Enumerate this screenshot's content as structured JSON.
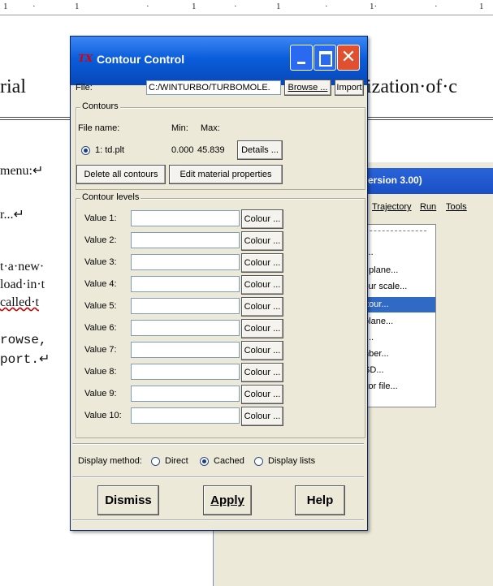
{
  "document": {
    "heading_left": "rial",
    "heading_right": "ization·of·c",
    "lines": [
      {
        "text": "menu:↵",
        "mono": false
      },
      {
        "text": "r...↵",
        "mono": false
      },
      {
        "text": "t·a·new·",
        "mono": false
      },
      {
        "text": "load·in·t",
        "mono": false
      },
      {
        "text": "called·t",
        "mono": false
      },
      {
        "text": "rowse,",
        "mono": true
      },
      {
        "text": "port.↵",
        "mono": true
      }
    ]
  },
  "bg_window": {
    "title": "ersion 3.00)",
    "menubar": [
      "Trajectory",
      "Run",
      "Tools"
    ],
    "menu_items": [
      "s...",
      "p plane...",
      "lour scale...",
      "ntour...",
      "tplane...",
      "P...",
      "mber...",
      "ISD...",
      "ctor file..."
    ],
    "selected_index": 3
  },
  "dialog": {
    "title": "Contour Control",
    "icon_text": "TX",
    "file_label": "File:",
    "file_value": "C:/WINTURBO/TURBOMOLE.",
    "browse_label": "Browse ...",
    "import_label": "Import",
    "contours": {
      "group_title": "Contours",
      "col_file": "File name:",
      "col_min": "Min:",
      "col_max": "Max:",
      "entry_name": "1: td.plt",
      "entry_min": "0.000",
      "entry_max": "45.839",
      "details_label": "Details ...",
      "delete_label": "Delete all contours",
      "edit_label": "Edit material properties"
    },
    "levels": {
      "group_title": "Contour levels",
      "colour_label": "Colour ...",
      "values": [
        {
          "label": "Value 1:",
          "value": ""
        },
        {
          "label": "Value 2:",
          "value": ""
        },
        {
          "label": "Value 3:",
          "value": ""
        },
        {
          "label": "Value 4:",
          "value": ""
        },
        {
          "label": "Value 5:",
          "value": ""
        },
        {
          "label": "Value 6:",
          "value": ""
        },
        {
          "label": "Value 7:",
          "value": ""
        },
        {
          "label": "Value 8:",
          "value": ""
        },
        {
          "label": "Value 9:",
          "value": ""
        },
        {
          "label": "Value 10:",
          "value": ""
        }
      ]
    },
    "display": {
      "label": "Display method:",
      "options": [
        "Direct",
        "Cached",
        "Display lists"
      ],
      "selected": "Cached"
    },
    "buttons": {
      "dismiss": "Dismiss",
      "apply": "Apply",
      "help": "Help"
    }
  }
}
